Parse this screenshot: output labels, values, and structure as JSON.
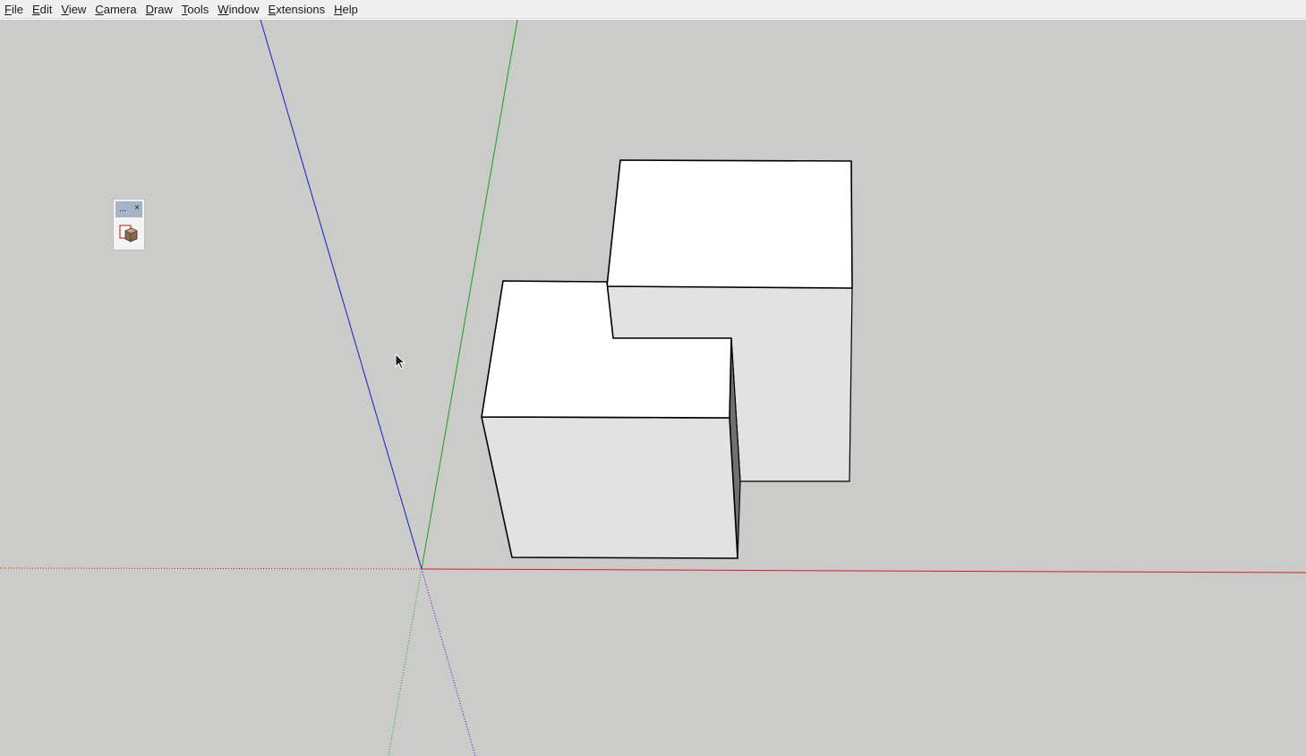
{
  "menubar": {
    "items": [
      {
        "label": "File",
        "accel": "F",
        "rest": "ile"
      },
      {
        "label": "Edit",
        "accel": "E",
        "rest": "dit"
      },
      {
        "label": "View",
        "accel": "V",
        "rest": "iew"
      },
      {
        "label": "Camera",
        "accel": "C",
        "rest": "amera"
      },
      {
        "label": "Draw",
        "accel": "D",
        "rest": "raw"
      },
      {
        "label": "Tools",
        "accel": "T",
        "rest": "ools"
      },
      {
        "label": "Window",
        "accel": "W",
        "rest": "indow"
      },
      {
        "label": "Extensions",
        "accel": "E",
        "rest": "xtensions"
      },
      {
        "label": "Help",
        "accel": "H",
        "rest": "elp"
      }
    ]
  },
  "floating_toolbar": {
    "title_dots": "...",
    "close_glyph": "×",
    "tool_icon": "component-icon"
  },
  "viewport": {
    "background_color": "#cbcbc9",
    "axis_colors": {
      "red": "#d42020",
      "green": "#1e9e1e",
      "blue": "#1a1acc"
    },
    "face_colors": {
      "top": "#ffffff",
      "side": "#e2e2e2",
      "shadow": "#707070"
    }
  }
}
